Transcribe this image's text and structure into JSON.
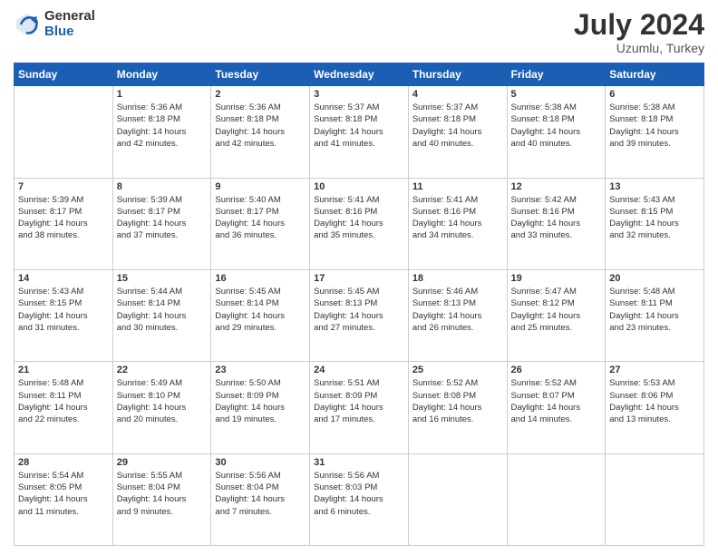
{
  "header": {
    "logo": {
      "general": "General",
      "blue": "Blue"
    },
    "title": "July 2024",
    "subtitle": "Uzumlu, Turkey"
  },
  "days_of_week": [
    "Sunday",
    "Monday",
    "Tuesday",
    "Wednesday",
    "Thursday",
    "Friday",
    "Saturday"
  ],
  "weeks": [
    [
      {
        "day": "",
        "lines": []
      },
      {
        "day": "1",
        "lines": [
          "Sunrise: 5:36 AM",
          "Sunset: 8:18 PM",
          "Daylight: 14 hours",
          "and 42 minutes."
        ]
      },
      {
        "day": "2",
        "lines": [
          "Sunrise: 5:36 AM",
          "Sunset: 8:18 PM",
          "Daylight: 14 hours",
          "and 42 minutes."
        ]
      },
      {
        "day": "3",
        "lines": [
          "Sunrise: 5:37 AM",
          "Sunset: 8:18 PM",
          "Daylight: 14 hours",
          "and 41 minutes."
        ]
      },
      {
        "day": "4",
        "lines": [
          "Sunrise: 5:37 AM",
          "Sunset: 8:18 PM",
          "Daylight: 14 hours",
          "and 40 minutes."
        ]
      },
      {
        "day": "5",
        "lines": [
          "Sunrise: 5:38 AM",
          "Sunset: 8:18 PM",
          "Daylight: 14 hours",
          "and 40 minutes."
        ]
      },
      {
        "day": "6",
        "lines": [
          "Sunrise: 5:38 AM",
          "Sunset: 8:18 PM",
          "Daylight: 14 hours",
          "and 39 minutes."
        ]
      }
    ],
    [
      {
        "day": "7",
        "lines": [
          "Sunrise: 5:39 AM",
          "Sunset: 8:17 PM",
          "Daylight: 14 hours",
          "and 38 minutes."
        ]
      },
      {
        "day": "8",
        "lines": [
          "Sunrise: 5:39 AM",
          "Sunset: 8:17 PM",
          "Daylight: 14 hours",
          "and 37 minutes."
        ]
      },
      {
        "day": "9",
        "lines": [
          "Sunrise: 5:40 AM",
          "Sunset: 8:17 PM",
          "Daylight: 14 hours",
          "and 36 minutes."
        ]
      },
      {
        "day": "10",
        "lines": [
          "Sunrise: 5:41 AM",
          "Sunset: 8:16 PM",
          "Daylight: 14 hours",
          "and 35 minutes."
        ]
      },
      {
        "day": "11",
        "lines": [
          "Sunrise: 5:41 AM",
          "Sunset: 8:16 PM",
          "Daylight: 14 hours",
          "and 34 minutes."
        ]
      },
      {
        "day": "12",
        "lines": [
          "Sunrise: 5:42 AM",
          "Sunset: 8:16 PM",
          "Daylight: 14 hours",
          "and 33 minutes."
        ]
      },
      {
        "day": "13",
        "lines": [
          "Sunrise: 5:43 AM",
          "Sunset: 8:15 PM",
          "Daylight: 14 hours",
          "and 32 minutes."
        ]
      }
    ],
    [
      {
        "day": "14",
        "lines": [
          "Sunrise: 5:43 AM",
          "Sunset: 8:15 PM",
          "Daylight: 14 hours",
          "and 31 minutes."
        ]
      },
      {
        "day": "15",
        "lines": [
          "Sunrise: 5:44 AM",
          "Sunset: 8:14 PM",
          "Daylight: 14 hours",
          "and 30 minutes."
        ]
      },
      {
        "day": "16",
        "lines": [
          "Sunrise: 5:45 AM",
          "Sunset: 8:14 PM",
          "Daylight: 14 hours",
          "and 29 minutes."
        ]
      },
      {
        "day": "17",
        "lines": [
          "Sunrise: 5:45 AM",
          "Sunset: 8:13 PM",
          "Daylight: 14 hours",
          "and 27 minutes."
        ]
      },
      {
        "day": "18",
        "lines": [
          "Sunrise: 5:46 AM",
          "Sunset: 8:13 PM",
          "Daylight: 14 hours",
          "and 26 minutes."
        ]
      },
      {
        "day": "19",
        "lines": [
          "Sunrise: 5:47 AM",
          "Sunset: 8:12 PM",
          "Daylight: 14 hours",
          "and 25 minutes."
        ]
      },
      {
        "day": "20",
        "lines": [
          "Sunrise: 5:48 AM",
          "Sunset: 8:11 PM",
          "Daylight: 14 hours",
          "and 23 minutes."
        ]
      }
    ],
    [
      {
        "day": "21",
        "lines": [
          "Sunrise: 5:48 AM",
          "Sunset: 8:11 PM",
          "Daylight: 14 hours",
          "and 22 minutes."
        ]
      },
      {
        "day": "22",
        "lines": [
          "Sunrise: 5:49 AM",
          "Sunset: 8:10 PM",
          "Daylight: 14 hours",
          "and 20 minutes."
        ]
      },
      {
        "day": "23",
        "lines": [
          "Sunrise: 5:50 AM",
          "Sunset: 8:09 PM",
          "Daylight: 14 hours",
          "and 19 minutes."
        ]
      },
      {
        "day": "24",
        "lines": [
          "Sunrise: 5:51 AM",
          "Sunset: 8:09 PM",
          "Daylight: 14 hours",
          "and 17 minutes."
        ]
      },
      {
        "day": "25",
        "lines": [
          "Sunrise: 5:52 AM",
          "Sunset: 8:08 PM",
          "Daylight: 14 hours",
          "and 16 minutes."
        ]
      },
      {
        "day": "26",
        "lines": [
          "Sunrise: 5:52 AM",
          "Sunset: 8:07 PM",
          "Daylight: 14 hours",
          "and 14 minutes."
        ]
      },
      {
        "day": "27",
        "lines": [
          "Sunrise: 5:53 AM",
          "Sunset: 8:06 PM",
          "Daylight: 14 hours",
          "and 13 minutes."
        ]
      }
    ],
    [
      {
        "day": "28",
        "lines": [
          "Sunrise: 5:54 AM",
          "Sunset: 8:05 PM",
          "Daylight: 14 hours",
          "and 11 minutes."
        ]
      },
      {
        "day": "29",
        "lines": [
          "Sunrise: 5:55 AM",
          "Sunset: 8:04 PM",
          "Daylight: 14 hours",
          "and 9 minutes."
        ]
      },
      {
        "day": "30",
        "lines": [
          "Sunrise: 5:56 AM",
          "Sunset: 8:04 PM",
          "Daylight: 14 hours",
          "and 7 minutes."
        ]
      },
      {
        "day": "31",
        "lines": [
          "Sunrise: 5:56 AM",
          "Sunset: 8:03 PM",
          "Daylight: 14 hours",
          "and 6 minutes."
        ]
      },
      {
        "day": "",
        "lines": []
      },
      {
        "day": "",
        "lines": []
      },
      {
        "day": "",
        "lines": []
      }
    ]
  ]
}
